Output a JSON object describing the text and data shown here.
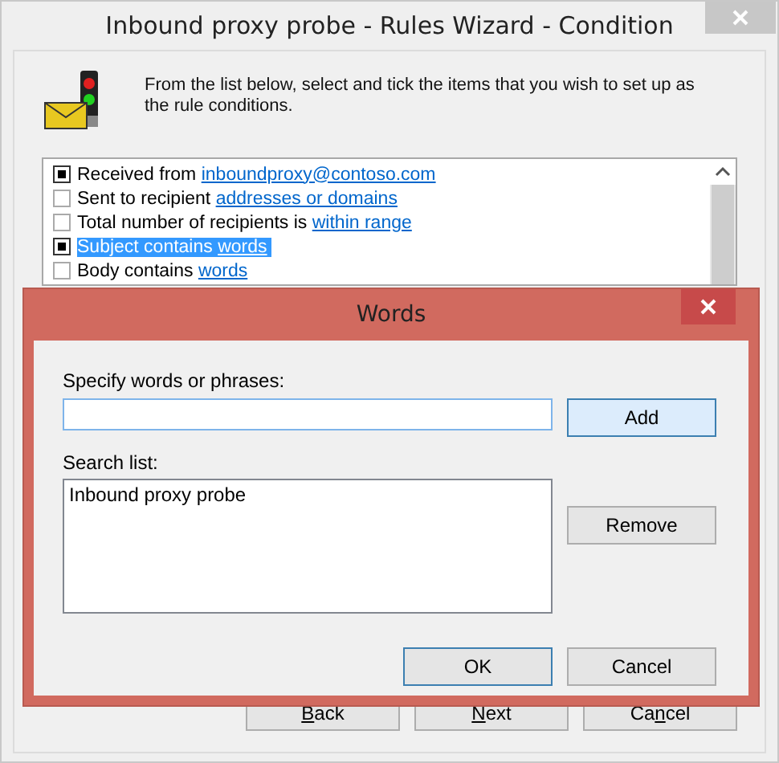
{
  "window": {
    "title": "Inbound proxy probe - Rules Wizard - Condition"
  },
  "instructions": "From the list below, select and tick the items that you wish to set up as the rule conditions.",
  "conditions": [
    {
      "text": "Received from ",
      "link": "inboundproxy@contoso.com",
      "checked": true,
      "selected": false
    },
    {
      "text": "Sent to recipient ",
      "link": "addresses or domains",
      "checked": false,
      "selected": false
    },
    {
      "text": "Total number of recipients is ",
      "link": "within range",
      "checked": false,
      "selected": false
    },
    {
      "text": "Subject contains ",
      "link": "words",
      "checked": true,
      "selected": true
    },
    {
      "text": "Body contains ",
      "link": "words",
      "checked": false,
      "selected": false
    }
  ],
  "wizard_buttons": [
    {
      "accelerator": "B",
      "label_after": "ack"
    },
    {
      "accelerator": "N",
      "label_after": "ext"
    },
    {
      "label_before": "Ca",
      "accelerator": "n",
      "label_after": "cel"
    }
  ],
  "dialog": {
    "title": "Words",
    "input_label": "Specify words or phrases:",
    "add_button": "Add",
    "list_label": "Search list:",
    "search_list": [
      "Inbound proxy probe"
    ],
    "remove_button": "Remove",
    "ok_button": "OK",
    "cancel_button": "Cancel"
  }
}
